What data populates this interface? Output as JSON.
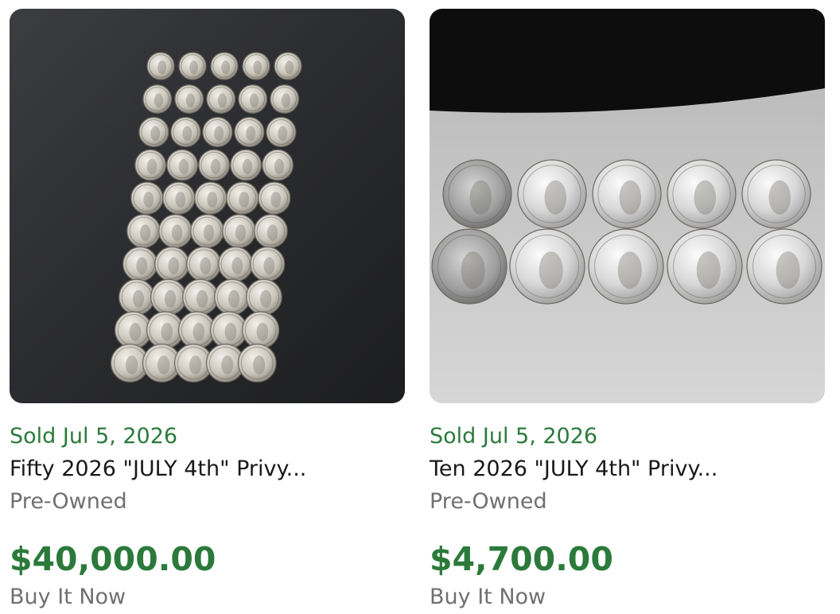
{
  "listings": [
    {
      "sold_label": "Sold Jul 5, 2026",
      "title": "Fifty 2026 \"JULY 4th\" Privy...",
      "condition": "Pre-Owned",
      "price": "$40,000.00",
      "buy_format": "Buy It Now",
      "image_icon": "coin-photo-fifty"
    },
    {
      "sold_label": "Sold Jul 5, 2026",
      "title": "Ten 2026 \"JULY 4th\" Privy...",
      "condition": "Pre-Owned",
      "price": "$4,700.00",
      "buy_format": "Buy It Now",
      "image_icon": "coin-photo-ten"
    }
  ],
  "colors": {
    "sold_green": "#2b7a3b",
    "title_text": "#191919",
    "secondary_text": "#707070"
  }
}
